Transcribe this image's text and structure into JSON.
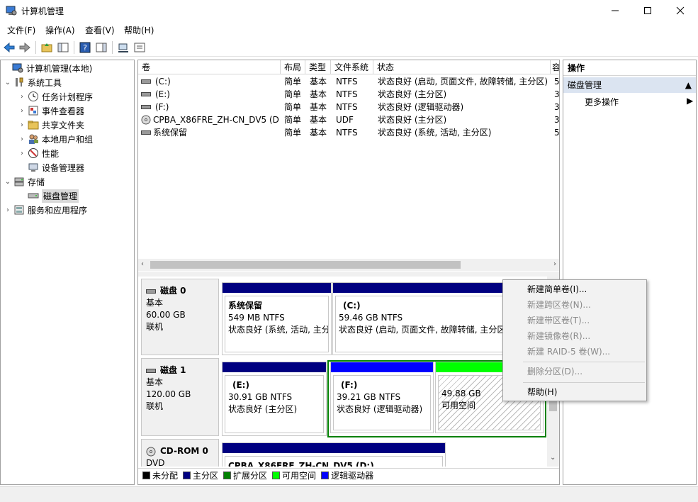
{
  "window": {
    "title": "计算机管理"
  },
  "menu": [
    "文件(F)",
    "操作(A)",
    "查看(V)",
    "帮助(H)"
  ],
  "tree": {
    "root": "计算机管理(本地)",
    "system_tools": "系统工具",
    "task_scheduler": "任务计划程序",
    "event_viewer": "事件查看器",
    "shared_folders": "共享文件夹",
    "local_users": "本地用户和组",
    "performance": "性能",
    "device_manager": "设备管理器",
    "storage": "存储",
    "disk_management": "磁盘管理",
    "services_apps": "服务和应用程序"
  },
  "volume_table": {
    "headers": [
      "卷",
      "布局",
      "类型",
      "文件系统",
      "状态",
      "容"
    ],
    "rows": [
      {
        "name": "(C:)",
        "layout": "简单",
        "type": "基本",
        "fs": "NTFS",
        "status": "状态良好 (启动, 页面文件, 故障转储, 主分区)",
        "cap": "5"
      },
      {
        "name": "(E:)",
        "layout": "简单",
        "type": "基本",
        "fs": "NTFS",
        "status": "状态良好 (主分区)",
        "cap": "3"
      },
      {
        "name": "(F:)",
        "layout": "简单",
        "type": "基本",
        "fs": "NTFS",
        "status": "状态良好 (逻辑驱动器)",
        "cap": "3"
      },
      {
        "name": "CPBA_X86FRE_ZH-CN_DV5 (D:)",
        "layout": "简单",
        "type": "基本",
        "fs": "UDF",
        "status": "状态良好 (主分区)",
        "cap": "3"
      },
      {
        "name": "系统保留",
        "layout": "简单",
        "type": "基本",
        "fs": "NTFS",
        "status": "状态良好 (系统, 活动, 主分区)",
        "cap": "5"
      }
    ]
  },
  "disks": {
    "disk0": {
      "name": "磁盘 0",
      "kind": "基本",
      "size": "60.00 GB",
      "state": "联机",
      "p1": {
        "name": "系统保留",
        "size": "549 MB NTFS",
        "status": "状态良好 (系统, 活动, 主分"
      },
      "p2": {
        "name": "(C:)",
        "size": "59.46 GB NTFS",
        "status": "状态良好 (启动, 页面文件, 故障转储, 主分区)"
      }
    },
    "disk1": {
      "name": "磁盘 1",
      "kind": "基本",
      "size": "120.00 GB",
      "state": "联机",
      "p1": {
        "name": "(E:)",
        "size": "30.91 GB NTFS",
        "status": "状态良好 (主分区)"
      },
      "p2": {
        "name": "(F:)",
        "size": "39.21 GB NTFS",
        "status": "状态良好 (逻辑驱动器)"
      },
      "p3": {
        "size": "49.88 GB",
        "status": "可用空间"
      }
    },
    "cdrom0": {
      "name": "CD-ROM 0",
      "kind": "DVD",
      "p1": {
        "name": "CPBA_X86FRE_ZH-CN_DV5  (D:)"
      }
    }
  },
  "legend": [
    "未分配",
    "主分区",
    "扩展分区",
    "可用空间",
    "逻辑驱动器"
  ],
  "legend_colors": [
    "#000000",
    "#000080",
    "#008000",
    "#00ff00",
    "#0000ff"
  ],
  "actions": {
    "header": "操作",
    "section": "磁盘管理",
    "more": "更多操作"
  },
  "context_menu": {
    "new_simple": "新建简单卷(I)...",
    "new_spanned": "新建跨区卷(N)...",
    "new_striped": "新建带区卷(T)...",
    "new_mirrored": "新建镜像卷(R)...",
    "new_raid5": "新建 RAID-5 卷(W)...",
    "delete_partition": "删除分区(D)...",
    "help": "帮助(H)"
  },
  "colors": {
    "primary_bar": "#000080",
    "logical_bar": "#0000ff",
    "free_bar": "#00ff00",
    "extended_border": "#008000",
    "selection": "#dbe4f1"
  }
}
